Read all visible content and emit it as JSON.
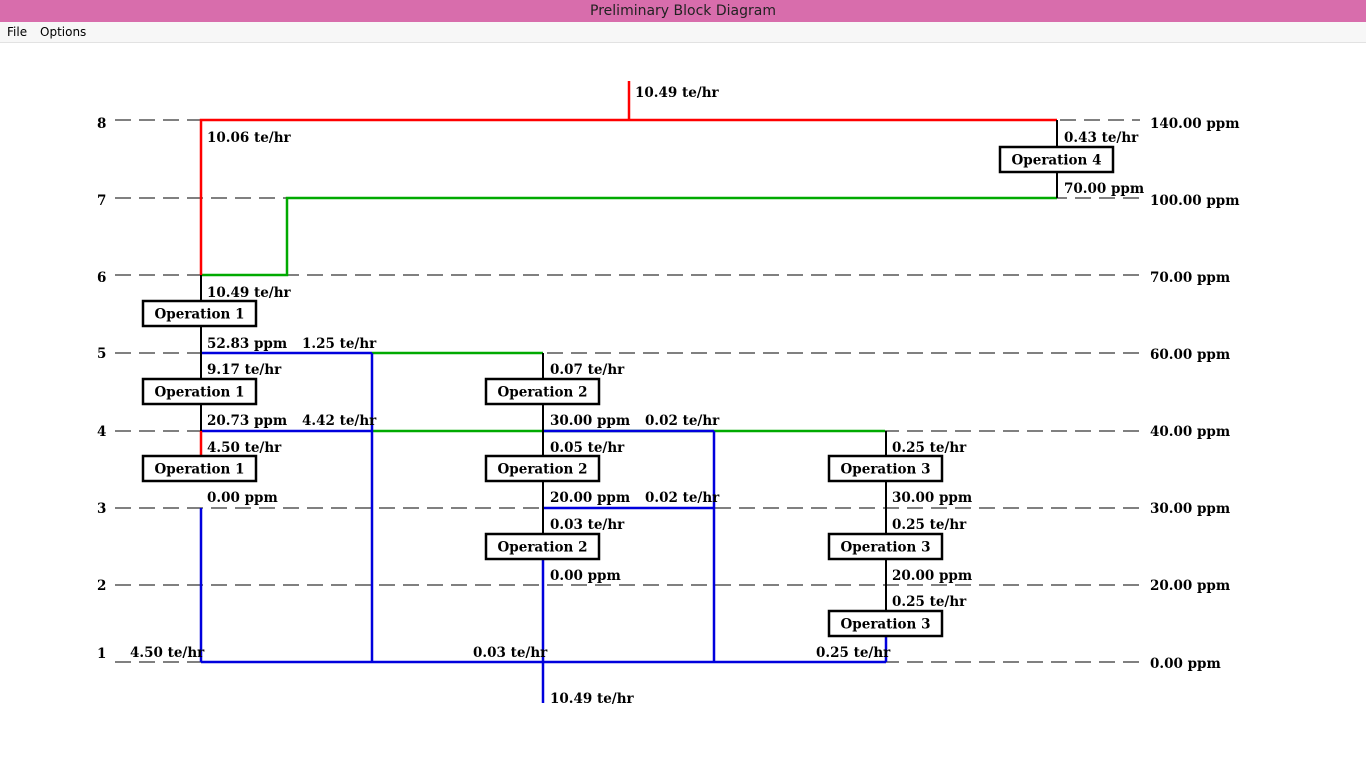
{
  "window": {
    "title": "Preliminary Block Diagram"
  },
  "menu": [
    {
      "id": "file",
      "label": "File"
    },
    {
      "id": "options",
      "label": "Options"
    }
  ],
  "diagram": {
    "levels": [
      {
        "num": "8",
        "conc": "140.00 ppm"
      },
      {
        "num": "7",
        "conc": "100.00 ppm"
      },
      {
        "num": "6",
        "conc": "70.00 ppm"
      },
      {
        "num": "5",
        "conc": "60.00 ppm"
      },
      {
        "num": "4",
        "conc": "40.00 ppm"
      },
      {
        "num": "3",
        "conc": "30.00 ppm"
      },
      {
        "num": "2",
        "conc": "20.00 ppm"
      },
      {
        "num": "1",
        "conc": "0.00 ppm"
      }
    ],
    "operations": [
      {
        "id": "op1-top",
        "label": "Operation 1"
      },
      {
        "id": "op1-mid",
        "label": "Operation 1"
      },
      {
        "id": "op1-bot",
        "label": "Operation 1"
      },
      {
        "id": "op2-top",
        "label": "Operation 2"
      },
      {
        "id": "op2-mid",
        "label": "Operation 2"
      },
      {
        "id": "op2-bot",
        "label": "Operation 2"
      },
      {
        "id": "op3-top",
        "label": "Operation 3"
      },
      {
        "id": "op3-mid",
        "label": "Operation 3"
      },
      {
        "id": "op3-bot",
        "label": "Operation 3"
      },
      {
        "id": "op4",
        "label": "Operation 4"
      }
    ],
    "labels": {
      "wastewater_out": "10.49 te/hr",
      "red_to_op1": "10.06 te/hr",
      "op4_in": "0.43 te/hr",
      "op4_out_conc": "70.00 ppm",
      "op1_top_in": "10.49 te/hr",
      "op1_top_out_conc": "52.83 ppm",
      "flow_1_25": "1.25 te/hr",
      "op1_mid_in": "9.17 te/hr",
      "op1_mid_out_conc": "20.73 ppm",
      "flow_4_42": "4.42 te/hr",
      "op1_bot_in": "4.50 te/hr",
      "op1_bot_out_conc": "0.00 ppm",
      "op2_top_in": "0.07 te/hr",
      "op2_top_out_conc": "30.00 ppm",
      "flow_0_02_a": "0.02 te/hr",
      "op2_mid_in": "0.05 te/hr",
      "op2_mid_out_conc": "20.00 ppm",
      "flow_0_02_b": "0.02 te/hr",
      "op2_bot_in": "0.03 te/hr",
      "op2_bot_out_conc": "0.00 ppm",
      "op3_top_in": "0.25 te/hr",
      "op3_top_out_conc": "30.00 ppm",
      "op3_mid_in": "0.25 te/hr",
      "op3_mid_out_conc": "20.00 ppm",
      "op3_bot_in": "0.25 te/hr",
      "fresh_op1": "4.50 te/hr",
      "fresh_op2": "0.03 te/hr",
      "fresh_op3": "0.25 te/hr",
      "freshwater_in": "10.49 te/hr"
    }
  },
  "colors": {
    "wastewater": "#ff0000",
    "reuse": "#00aa00",
    "freshwater": "#0000dd",
    "operation_line": "#000000",
    "level_line": "#000000"
  }
}
